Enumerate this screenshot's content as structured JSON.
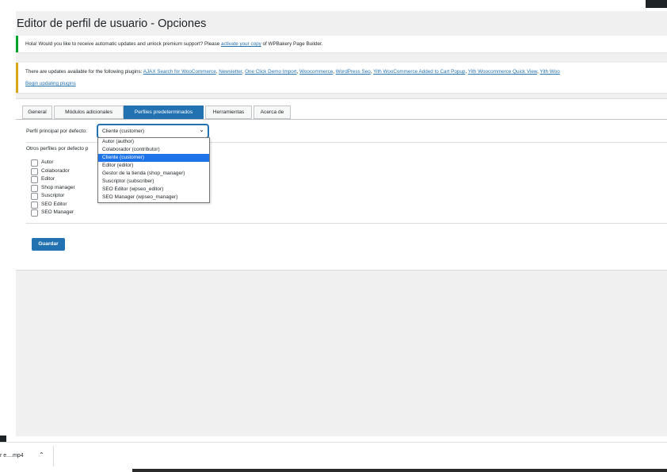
{
  "page": {
    "title": "Editor de perfil de usuario - Opciones"
  },
  "notices": {
    "wpbakery": {
      "before": "Hola! Would you like to receive automatic updates and unlock premium support? Please ",
      "link": "activate your copy",
      "after": " of WPBakery Page Builder."
    },
    "updates": {
      "intro": "There are updates available for the following plugins: ",
      "plugins": [
        "AJAX Search for WooCommerce",
        "Newsletter",
        "One Click Demo Import",
        "Woocommerce",
        "WordPress Seo",
        "Yith WooCommerce Added to Cart Popup",
        "Yith Woocommerce Quick View",
        "Yith Woo"
      ],
      "begin_link": "Begin updating plugins"
    }
  },
  "tabs": [
    "General",
    "Módulos adicionales",
    "Perfiles predeterminados",
    "Herramientas",
    "Acerca de"
  ],
  "active_tab": "Perfiles predeterminados",
  "form": {
    "principal_label": "Perfil principal por defecto:",
    "principal_value": "Cliente (customer)",
    "otros_label": "Otros perfiles por defecto p",
    "checkboxes": [
      "Autor",
      "Colaborador",
      "Editor",
      "Shop manager",
      "Suscriptor",
      "SEO Editor",
      "SEO Manager"
    ],
    "save_label": "Guardar"
  },
  "dropdown": {
    "options": [
      "Autor (author)",
      "Colaborador (contributor)",
      "Cliente (customer)",
      "Editor (editor)",
      "Gestor de la tienda (shop_manager)",
      "Suscriptor (subscriber)",
      "SEO Editor (wpseo_editor)",
      "SEO Manager (wpseo_manager)"
    ],
    "selected_index": 2
  },
  "downloads": {
    "file": "r e....mp4",
    "caret_icon": "chevron-up-icon"
  },
  "colors": {
    "primary": "#2271b1",
    "notice_green": "#00a32a",
    "notice_yellow": "#dba617",
    "selected": "#1e73e8"
  }
}
